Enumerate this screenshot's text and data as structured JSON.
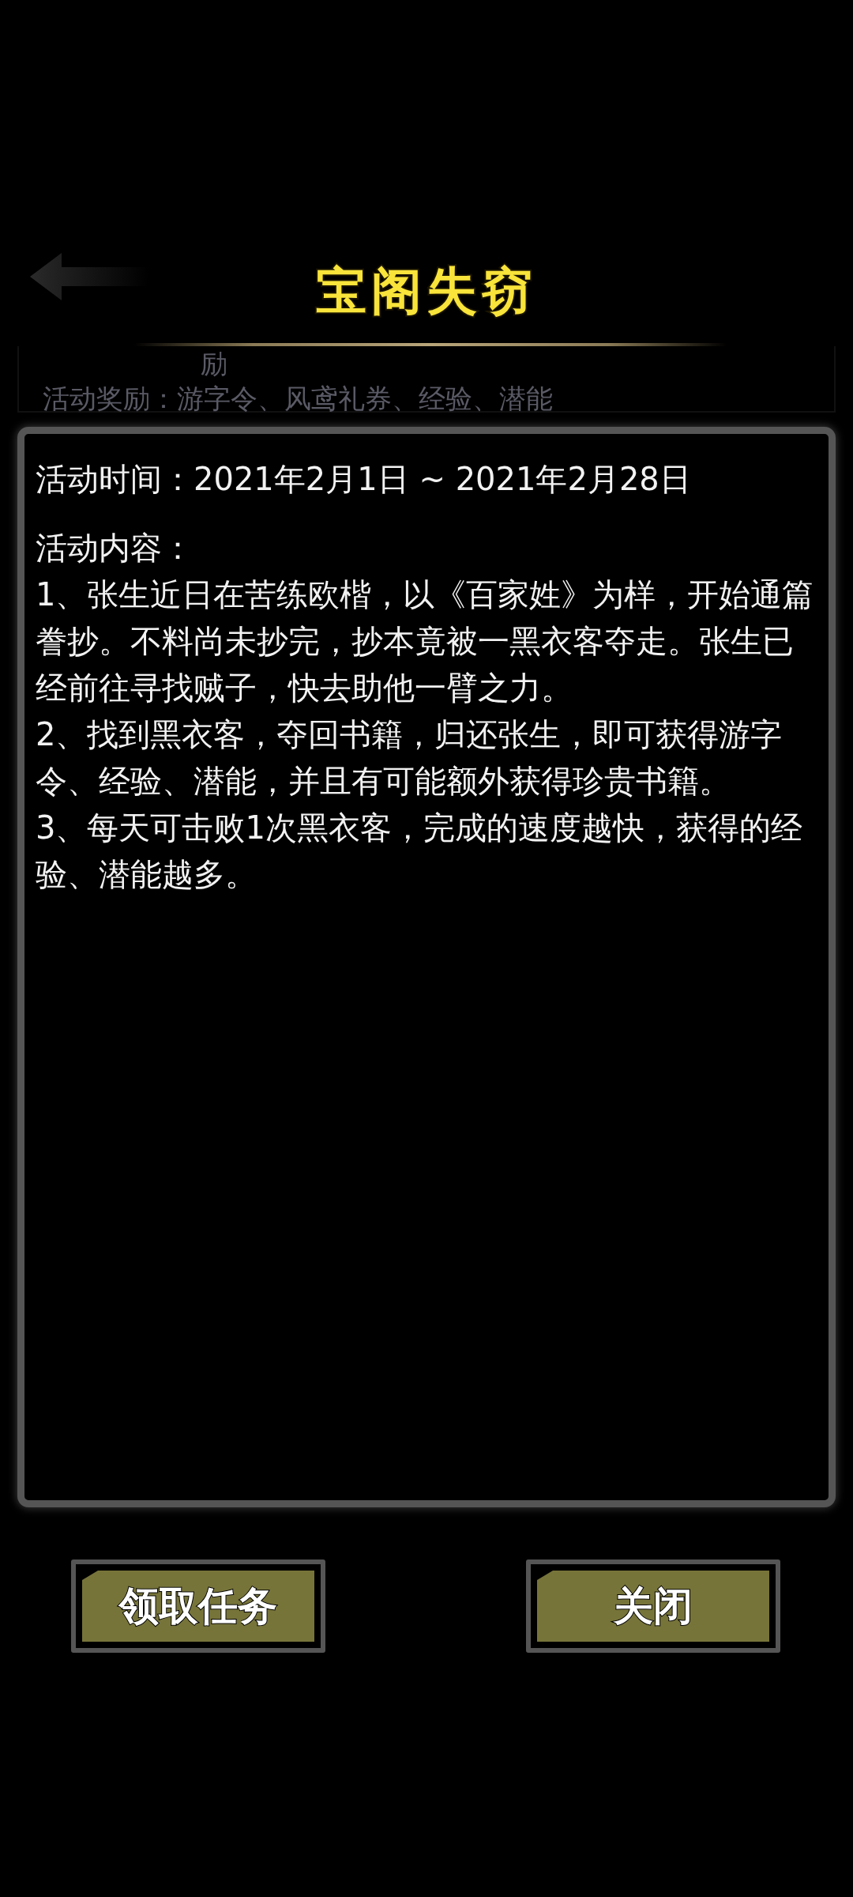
{
  "background_card": {
    "lines": [
      "励",
      "活动奖励：游字令、风鸢礼券、经验、潜能"
    ]
  },
  "dialog": {
    "title": "宝阁失窃",
    "time": "活动时间：2021年2月1日 ~ 2021年2月28日",
    "content_heading": "活动内容：",
    "items": [
      "1、张生近日在苦练欧楷，以《百家姓》为样，开始通篇誊抄。不料尚未抄完，抄本竟被一黑衣客夺走。张生已经前往寻找贼子，快去助他一臂之力。",
      "2、找到黑衣客，夺回书籍，归还张生，即可获得游字令、经验、潜能，并且有可能额外获得珍贵书籍。",
      "3、每天可击败1次黑衣客，完成的速度越快，获得的经验、潜能越多。"
    ]
  },
  "buttons": [
    {
      "label": "领取任务"
    },
    {
      "label": "关闭"
    }
  ]
}
